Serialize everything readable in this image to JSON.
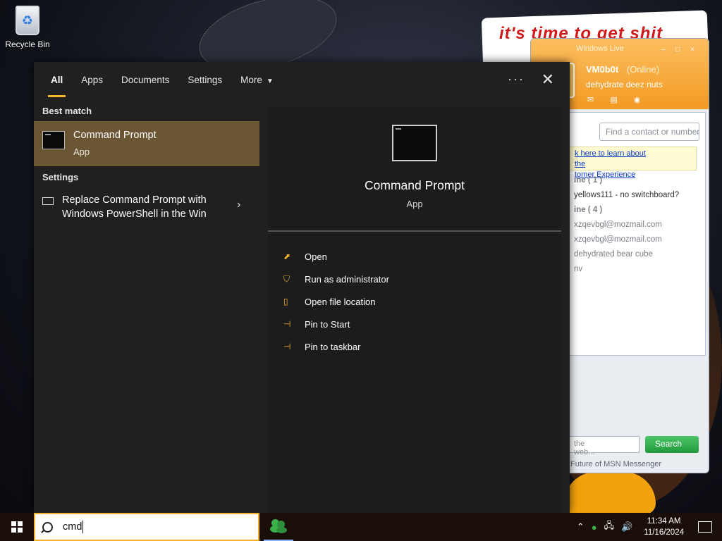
{
  "desktop": {
    "recycle_bin_label": "Recycle Bin",
    "poster_text": "it's time to get shit"
  },
  "msn": {
    "title": "Windows Live",
    "winbtns": "– □ ×",
    "username": "VM0b0t",
    "status": "(Online)",
    "personal_message": "dehydrate deez nuts",
    "find_placeholder": "Find a contact or number",
    "banner_line1": "k here to learn about the",
    "banner_line2": "tomer Experience",
    "contacts": [
      {
        "text": "ine ( 1 )",
        "kind": "group"
      },
      {
        "text": "yellows111 - no switchboard?",
        "kind": "contact"
      },
      {
        "text": "ine ( 4 )",
        "kind": "group"
      },
      {
        "text": "xzqevbgl@mozmail.com",
        "kind": "dim"
      },
      {
        "text": "xzqevbgl@mozmail.com",
        "kind": "dim"
      },
      {
        "text": "dehydrated bear cube",
        "kind": "dim"
      },
      {
        "text": "nv",
        "kind": "dim"
      }
    ],
    "web_placeholder": "the web...",
    "search_button": "Search",
    "footer": "Future of MSN Messenger"
  },
  "search_panel": {
    "tabs": [
      "All",
      "Apps",
      "Documents",
      "Settings",
      "More"
    ],
    "best_match_label": "Best match",
    "best_match": {
      "title": "Command Prompt",
      "subtitle": "App"
    },
    "settings_label": "Settings",
    "setting_item": "Replace Command Prompt with Windows PowerShell in the Win",
    "preview": {
      "title": "Command Prompt",
      "subtitle": "App"
    },
    "actions": [
      {
        "label": "Open",
        "icon": "open-icon"
      },
      {
        "label": "Run as administrator",
        "icon": "shield-icon"
      },
      {
        "label": "Open file location",
        "icon": "folder-icon"
      },
      {
        "label": "Pin to Start",
        "icon": "pin-icon"
      },
      {
        "label": "Pin to taskbar",
        "icon": "pin-icon"
      }
    ]
  },
  "taskbar": {
    "search_value": "cmd",
    "time": "11:34 AM",
    "date": "11/16/2024"
  },
  "colors": {
    "accent": "#f4b22e",
    "selected_item": "#6b5634",
    "panel": "#202020"
  }
}
